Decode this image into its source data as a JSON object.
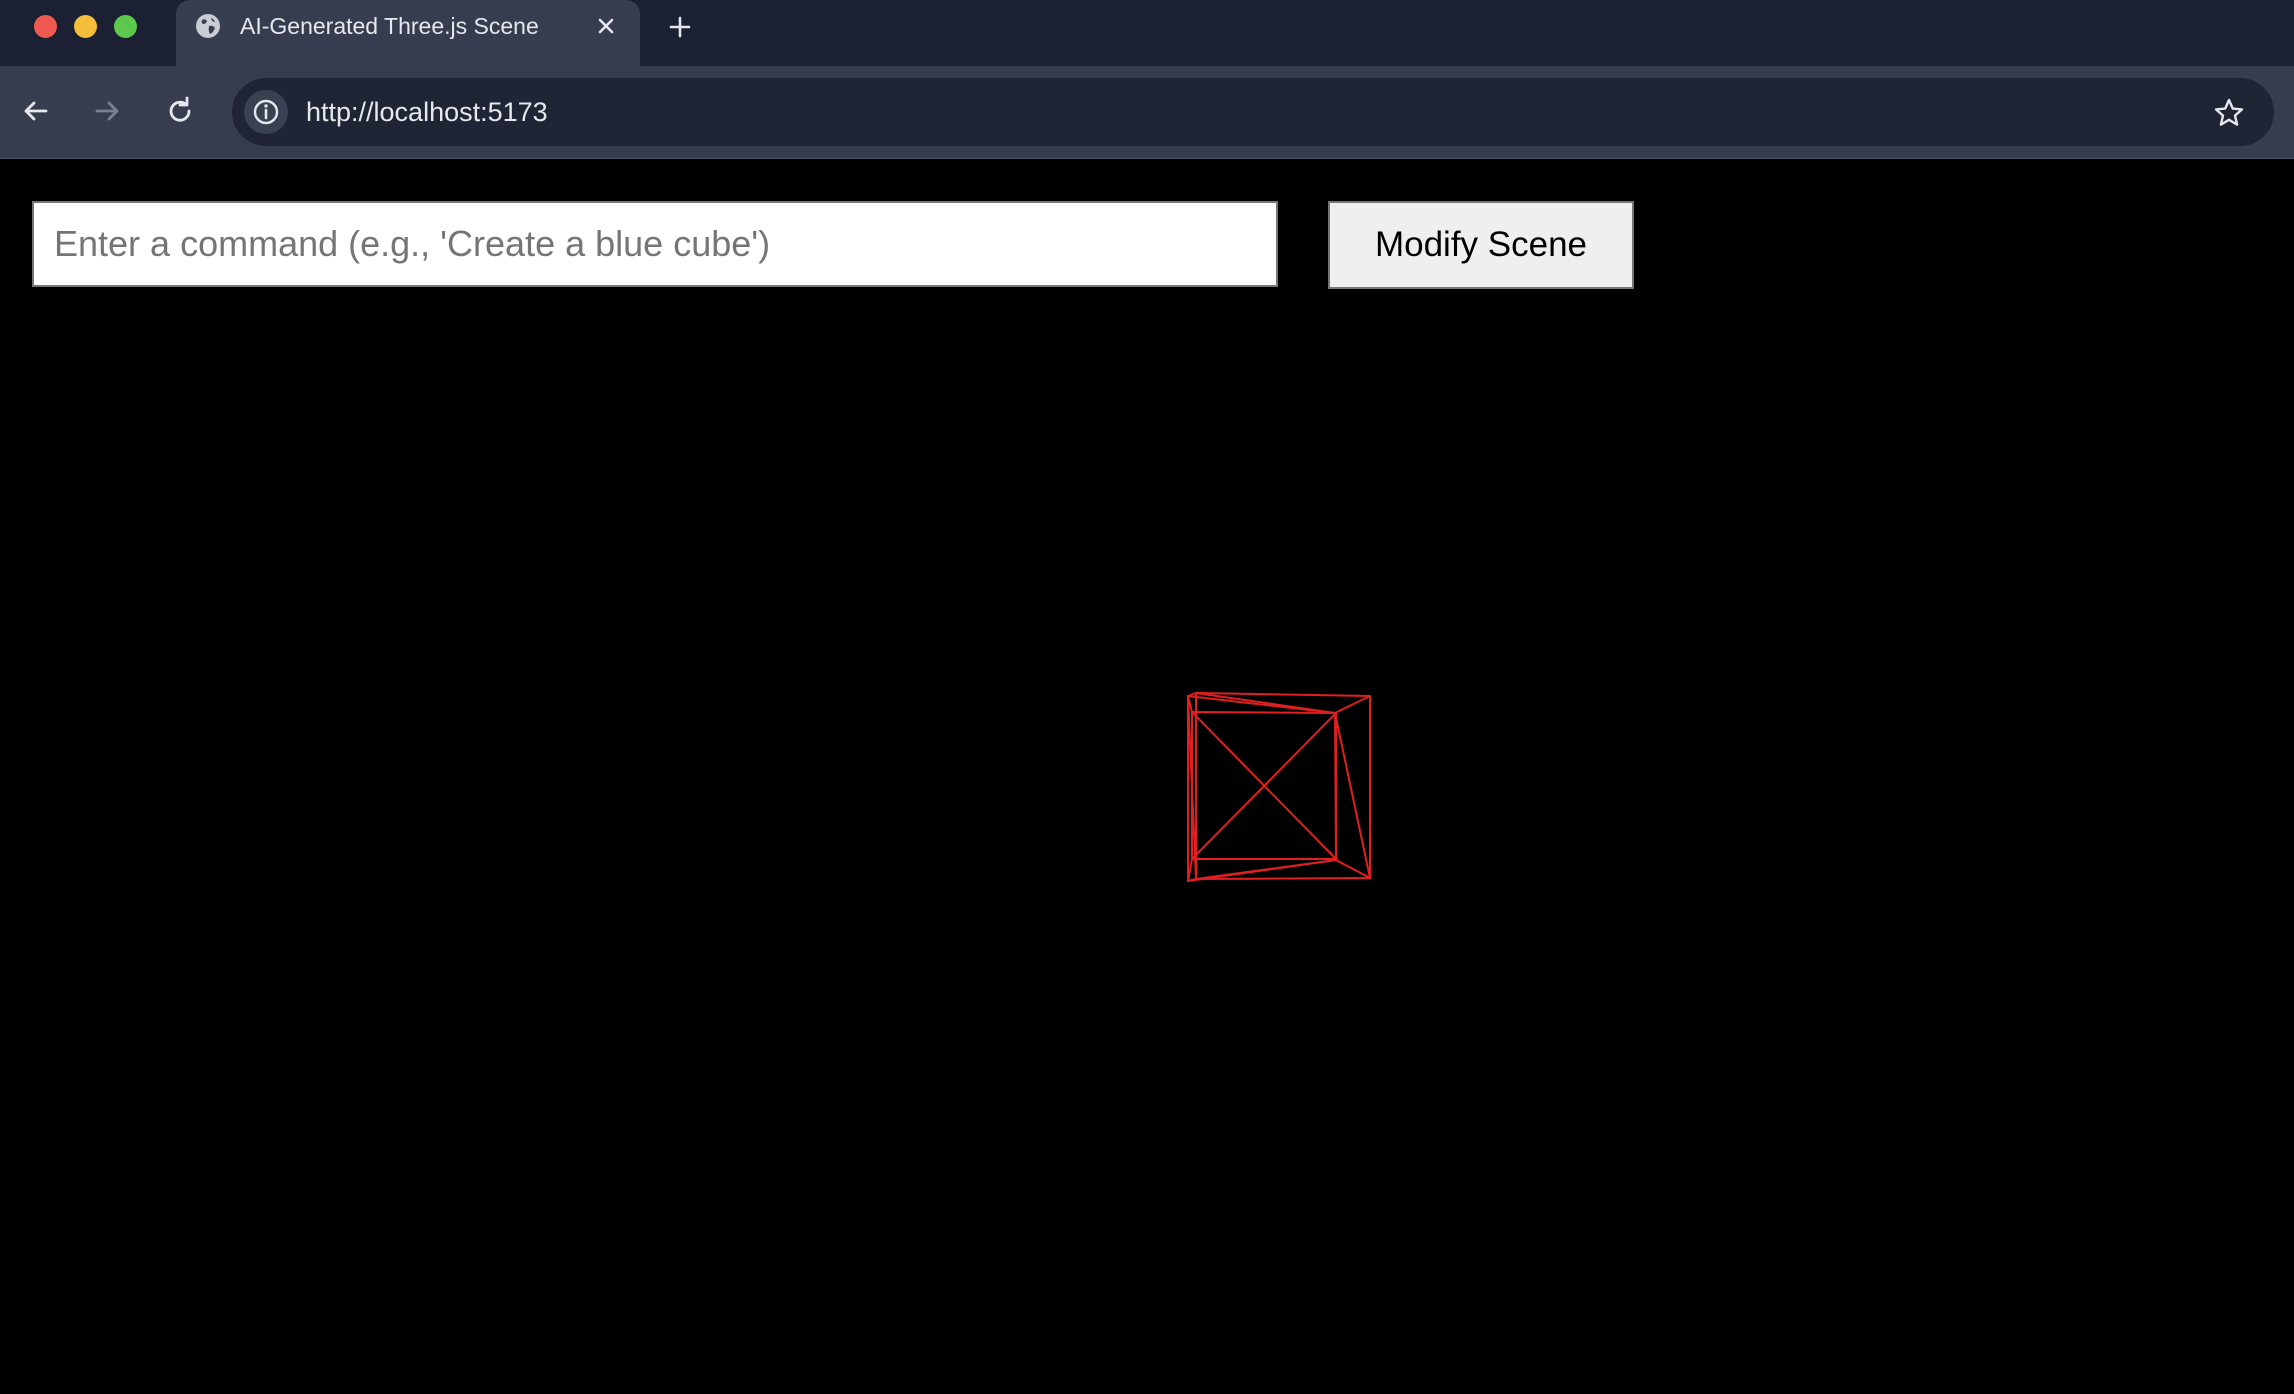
{
  "browser": {
    "tab": {
      "title": "AI-Generated Three.js Scene",
      "favicon": "globe-icon"
    },
    "address_bar": {
      "url": "http://localhost:5173"
    },
    "icons": [
      "back-icon",
      "forward-icon",
      "reload-icon",
      "info-icon",
      "star-icon",
      "close-icon",
      "plus-icon"
    ]
  },
  "page": {
    "command_input": {
      "value": "",
      "placeholder": "Enter a command (e.g., 'Create a blue cube')"
    },
    "modify_button": {
      "label": "Modify Scene"
    },
    "scene": {
      "background": "#000000",
      "object": {
        "shape": "cube",
        "render_mode": "wireframe",
        "color": "#e02020"
      }
    }
  }
}
